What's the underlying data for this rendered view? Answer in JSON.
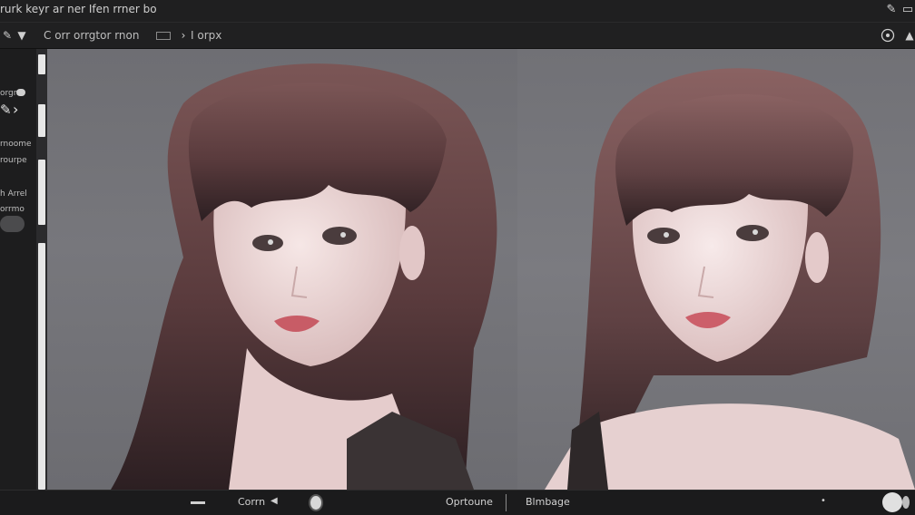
{
  "titlebar": {
    "title": "rurk keyr ar ner Ifen rrner bo"
  },
  "toolbar": {
    "left_label": "C orr orrgtor rnon",
    "right_label": "I orpx"
  },
  "left_panel": {
    "items": [
      "orgne",
      "rnoome",
      "rourpe",
      "h Arrel",
      "orrmo"
    ]
  },
  "bottom_bar": {
    "left_label": "Corrn",
    "center_label": "Oprtoune",
    "right_label": "Blmbage"
  },
  "colors": {
    "canvas_bg": "#75757a",
    "hair": "#6b4a4a",
    "skin": "#e9d3d3"
  }
}
